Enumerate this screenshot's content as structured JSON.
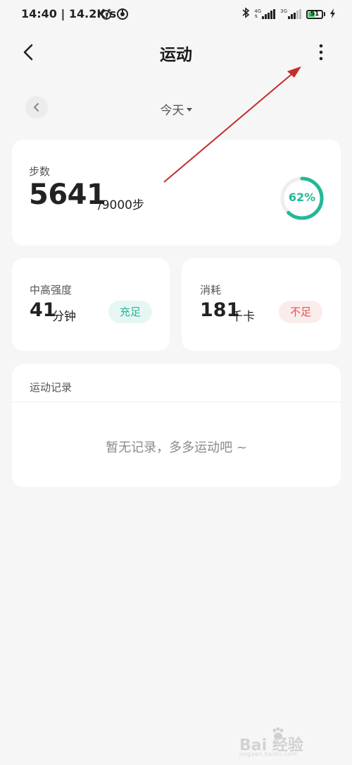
{
  "status_bar": {
    "time": "14:40 | 14.2K/s",
    "network_1": "4G",
    "network_2": "3G",
    "battery_level": "51",
    "battery_fraction": 0.51
  },
  "header": {
    "title": "运动"
  },
  "date_nav": {
    "selected": "今天"
  },
  "steps": {
    "label": "步数",
    "value": "5641",
    "goal": "/9000步",
    "percent_text": "62%",
    "progress": 0.62
  },
  "intensity": {
    "label": "中高强度",
    "value": "41",
    "unit": "分钟",
    "badge": "充足"
  },
  "calories": {
    "label": "消耗",
    "value": "181",
    "unit": "千卡",
    "badge": "不足"
  },
  "records": {
    "title": "运动记录",
    "empty_text": "暂无记录，多多运动吧 ~"
  },
  "watermark": {
    "text": "Bai 经验",
    "sub": "jingyan.baidu.com"
  },
  "colors": {
    "accent": "#23b89a",
    "warn": "#e2534a",
    "annotation_arrow": "#c62c2c"
  },
  "icons": {
    "back": "chevron-left-icon",
    "more": "more-vertical-icon",
    "prev_day": "chevron-left-icon",
    "dropdown": "caret-down-icon"
  }
}
